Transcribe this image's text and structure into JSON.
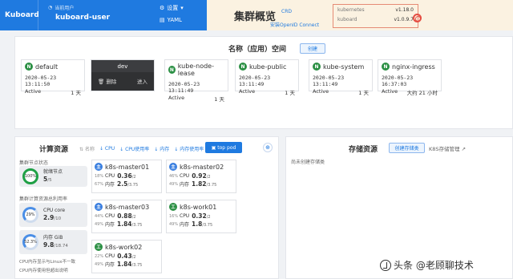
{
  "header": {
    "brand": "Kuboard",
    "current_user_label": "当前用户",
    "current_user": "kuboard-user",
    "settings_label": "设置",
    "yaml_label": "YAML",
    "overview_title": "集群概览",
    "crd_link": "CRD",
    "openid_link": "安装OpenID Connect",
    "versions": [
      {
        "name": "kubernetes",
        "value": "v1.18.0"
      },
      {
        "name": "kuboard",
        "value": "v1.0.9.7"
      }
    ]
  },
  "namespaces": {
    "title": "名称（应用）空间",
    "create_label": "创建",
    "items": [
      {
        "badge": "N",
        "name": "default",
        "time": "2020-05-23 13:11:50",
        "status": "Active",
        "age": "1 天"
      },
      {
        "badge": "N",
        "name": "kube-node-lease",
        "time": "2020-05-23 13:11:49",
        "status": "Active",
        "age": "1 天"
      },
      {
        "badge": "N",
        "name": "kube-public",
        "time": "2020-05-23 13:11:49",
        "status": "Active",
        "age": "1 天"
      },
      {
        "badge": "N",
        "name": "kube-system",
        "time": "2020-05-23 13:11:49",
        "status": "Active",
        "age": "1 天"
      },
      {
        "badge": "N",
        "name": "nginx-ingress",
        "time": "2020-05-23 16:37:03",
        "status": "Active",
        "age": "大约 21 小时"
      }
    ],
    "dev": {
      "name": "dev",
      "delete_label": "删除",
      "enter_label": "进入"
    }
  },
  "compute": {
    "title": "计算资源",
    "filter_label": "名称",
    "filters": [
      "CPU",
      "CPU使用率",
      "内存",
      "内存使用率"
    ],
    "top_pod_label": "top pod",
    "cluster_node_status": "集群节点状态",
    "ready_nodes": {
      "percent": "100%",
      "label": "就绪节点",
      "value": "5",
      "total": "/5"
    },
    "usage_title": "集群计算资源总利用率",
    "cpu": {
      "percent": "29%",
      "label": "CPU core",
      "value": "2.9",
      "total": "/10"
    },
    "mem": {
      "percent": "52.3%",
      "label": "内存 GiB",
      "value": "9.8",
      "total": "/18.74"
    },
    "footnotes": [
      "CPU内存显示与Linux不一致",
      "CPU内存使用但超出说明"
    ],
    "nodes": [
      {
        "badge": "主",
        "name": "k8s-master01",
        "cpu_pct": "18%",
        "cpu": "0.36",
        "cpu_total": "/2",
        "mem_pct": "67%",
        "mem": "2.5",
        "mem_total": "/3.75"
      },
      {
        "badge": "主",
        "name": "k8s-master02",
        "cpu_pct": "46%",
        "cpu": "0.92",
        "cpu_total": "/2",
        "mem_pct": "49%",
        "mem": "1.82",
        "mem_total": "/3.75"
      },
      {
        "badge": "主",
        "name": "k8s-master03",
        "cpu_pct": "44%",
        "cpu": "0.88",
        "cpu_total": "/2",
        "mem_pct": "49%",
        "mem": "1.84",
        "mem_total": "/3.75"
      },
      {
        "badge": "工",
        "name": "k8s-work01",
        "cpu_pct": "16%",
        "cpu": "0.32",
        "cpu_total": "/2",
        "mem_pct": "49%",
        "mem": "1.8",
        "mem_total": "/3.75"
      },
      {
        "badge": "工",
        "name": "k8s-work02",
        "cpu_pct": "22%",
        "cpu": "0.43",
        "cpu_total": "/2",
        "mem_pct": "49%",
        "mem": "1.84",
        "mem_total": "/3.75"
      }
    ],
    "cpu_label": "CPU",
    "mem_label": "内存"
  },
  "storage": {
    "title": "存储资源",
    "create_label": "创建存储类",
    "manage_label": "K8S存储管理",
    "empty_text": "尚未创建存储类"
  },
  "watermark": "头条 @老顾聊技术"
}
